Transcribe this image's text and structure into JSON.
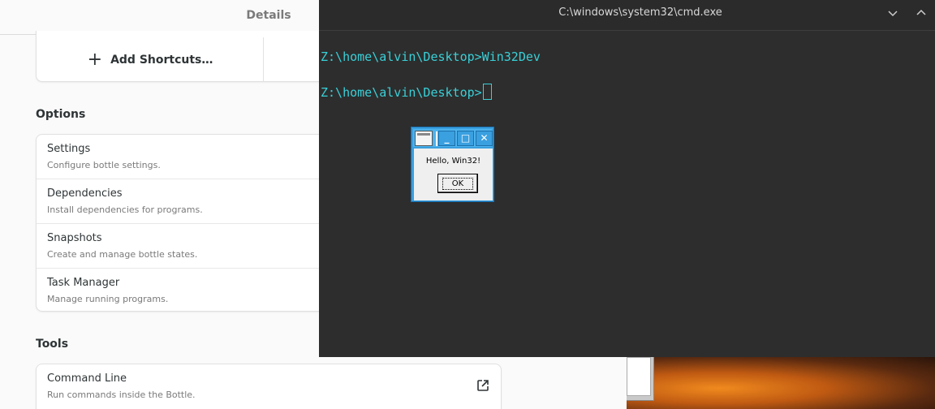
{
  "bottles": {
    "header_title": "Details",
    "add_shortcuts_label": "Add Shortcuts…",
    "options_title": "Options",
    "options": [
      {
        "title": "Settings",
        "subtitle": "Configure bottle settings."
      },
      {
        "title": "Dependencies",
        "subtitle": "Install dependencies for programs."
      },
      {
        "title": "Snapshots",
        "subtitle": "Create and manage bottle states."
      },
      {
        "title": "Task Manager",
        "subtitle": "Manage running programs."
      }
    ],
    "tools_title": "Tools",
    "tools": [
      {
        "title": "Command Line",
        "subtitle": "Run commands inside the Bottle.",
        "icon": "external-link-icon"
      }
    ]
  },
  "cmd": {
    "title": "C:\\windows\\system32\\cmd.exe",
    "lines": [
      "Z:\\home\\alvin\\Desktop>Win32Dev",
      "Z:\\home\\alvin\\Desktop>"
    ],
    "text_color": "#39d0d8"
  },
  "msgbox": {
    "message": "Hello, Win32!",
    "ok_label": "OK",
    "accent": "#3aa0e0"
  }
}
